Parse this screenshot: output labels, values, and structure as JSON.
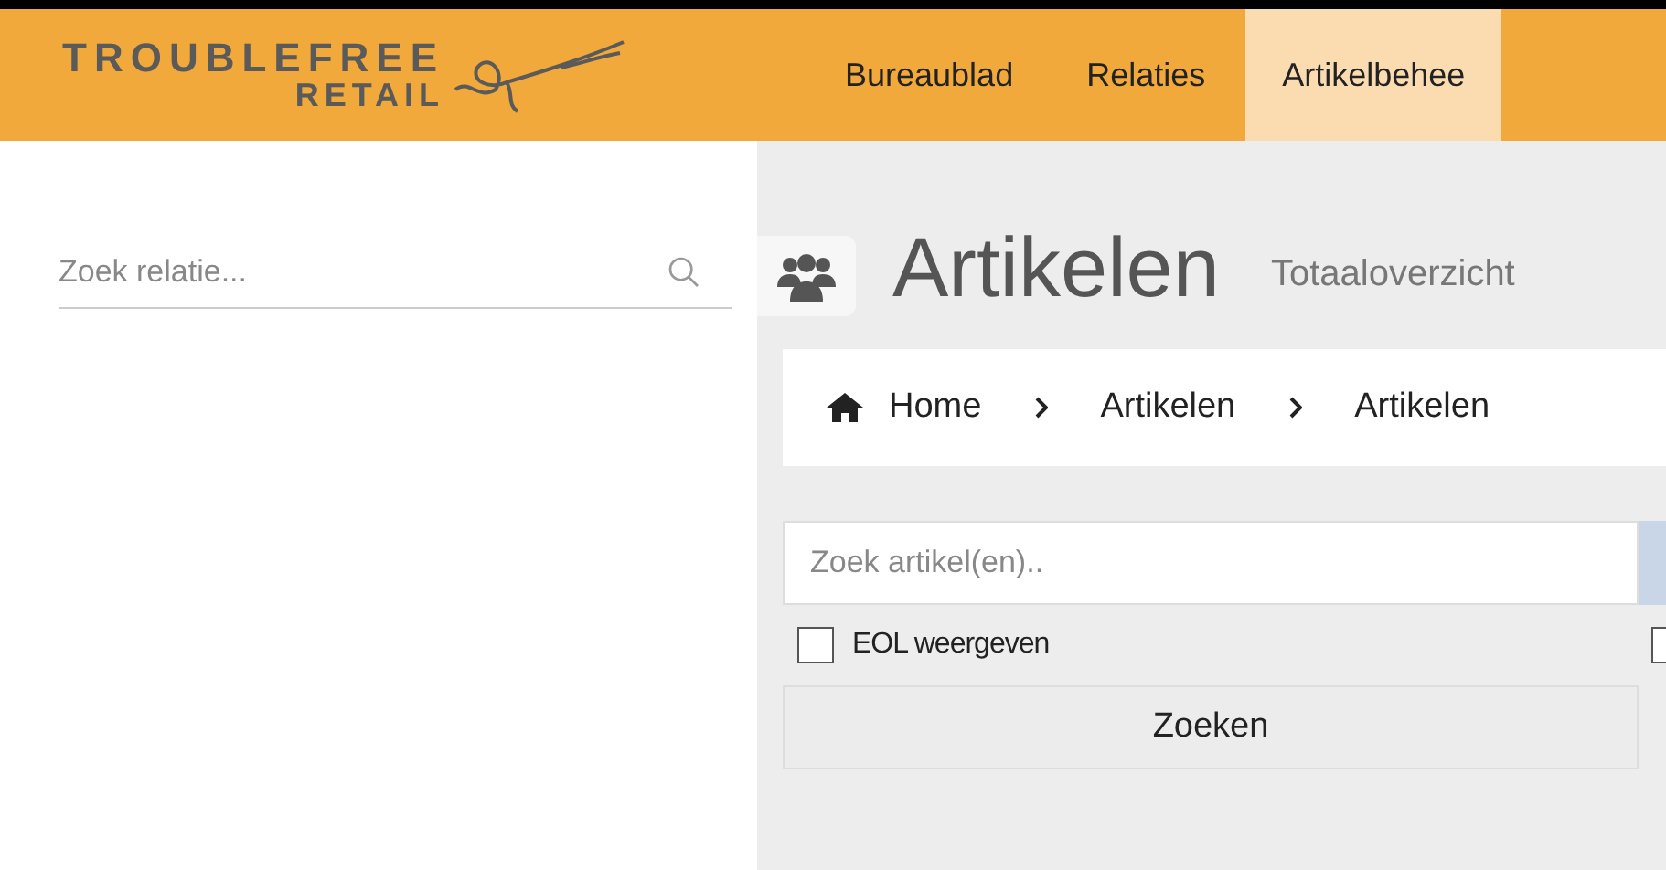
{
  "logo": {
    "line1": "TROUBLEFREE",
    "line2": "RETAIL"
  },
  "nav": [
    {
      "label": "Bureaublad",
      "selected": false
    },
    {
      "label": "Relaties",
      "selected": false
    },
    {
      "label": "Artikelbehee",
      "selected": true
    }
  ],
  "sidebar": {
    "search": {
      "placeholder": "Zoek relatie..."
    }
  },
  "page": {
    "title": "Artikelen",
    "subtitle": "Totaaloverzicht"
  },
  "breadcrumb": [
    "Home",
    "Artikelen",
    "Artikelen"
  ],
  "search": {
    "placeholder": "Zoek artikel(en).."
  },
  "checkboxes": [
    {
      "label": "EOL weergeven",
      "checked": false
    },
    {
      "checked": false
    }
  ],
  "button": "Zoeken"
}
